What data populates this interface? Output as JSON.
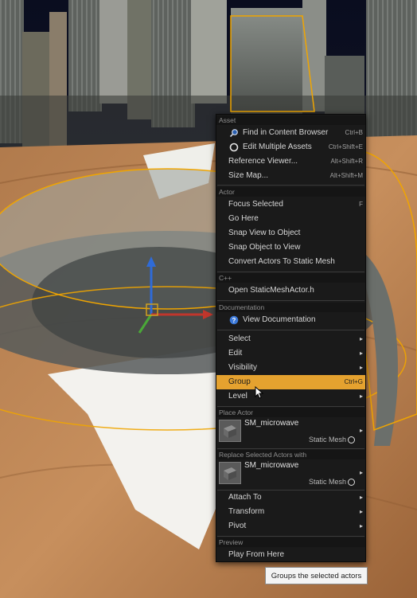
{
  "menu": {
    "sections": {
      "asset": "Asset",
      "actor": "Actor",
      "cpp": "C++",
      "documentation": "Documentation",
      "place_actor": "Place Actor",
      "replace_selected": "Replace Selected Actors with",
      "preview": "Preview"
    },
    "asset_items": [
      {
        "label": "Find in Content Browser",
        "shortcut": "Ctrl+B",
        "icon": "magnifier-icon"
      },
      {
        "label": "Edit Multiple Assets",
        "shortcut": "Ctrl+Shift+E",
        "icon": "circle-icon"
      },
      {
        "label": "Reference Viewer...",
        "shortcut": "Alt+Shift+R"
      },
      {
        "label": "Size Map...",
        "shortcut": "Alt+Shift+M"
      }
    ],
    "actor_items": [
      {
        "label": "Focus Selected",
        "shortcut": "F"
      },
      {
        "label": "Go Here"
      },
      {
        "label": "Snap View to Object"
      },
      {
        "label": "Snap Object to View"
      },
      {
        "label": "Convert Actors To Static Mesh"
      }
    ],
    "cpp_items": [
      {
        "label": "Open StaticMeshActor.h"
      }
    ],
    "doc_items": [
      {
        "label": "View Documentation",
        "icon": "help-icon"
      }
    ],
    "submenu_items": [
      {
        "label": "Select",
        "arrow": "▸"
      },
      {
        "label": "Edit",
        "arrow": "▸"
      },
      {
        "label": "Visibility",
        "arrow": "▸"
      },
      {
        "label": "Group",
        "shortcut": "Ctrl+G",
        "highlighted": true
      },
      {
        "label": "Level",
        "arrow": "▸"
      }
    ],
    "place_actor": {
      "name": "SM_microwave",
      "type": "Static Mesh",
      "arrow": "▸"
    },
    "replace_actor": {
      "name": "SM_microwave",
      "type": "Static Mesh",
      "arrow": "▸"
    },
    "attach_items": [
      {
        "label": "Attach To",
        "arrow": "▸"
      },
      {
        "label": "Transform",
        "arrow": "▸"
      },
      {
        "label": "Pivot",
        "arrow": "▸"
      }
    ],
    "preview_items": [
      {
        "label": "Play From Here"
      }
    ]
  },
  "tooltip": {
    "text": "Groups the selected actors"
  },
  "colors": {
    "highlight": "#e5a22f",
    "selection_outline": "#f0a500",
    "menu_bg": "#1a1a1a"
  }
}
